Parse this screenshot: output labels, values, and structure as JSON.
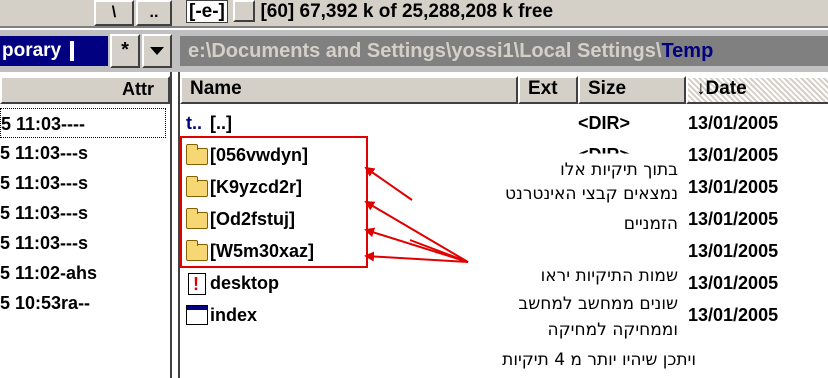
{
  "top_bar": {
    "btn1": "\\",
    "btn2": "..",
    "drive_select": "[-e-]",
    "drive_label": "[60]  67,392 k of 25,288,208 k free"
  },
  "path_bar": {
    "left_tab": "porary",
    "star": "*",
    "path_text": "e:\\Documents and Settings\\yossi1\\Local Settings\\",
    "path_end": "Temp"
  },
  "left_panel": {
    "header": "Attr",
    "rows": [
      "5 11:03----",
      "5 11:03---s",
      "5 11:03---s",
      "5 11:03---s",
      "5 11:03---s",
      "5 11:02-ahs",
      "5 10:53ra--"
    ]
  },
  "columns": {
    "name": "Name",
    "ext": "Ext",
    "size": "Size",
    "date": "↓Date"
  },
  "files": [
    {
      "name": "[..]",
      "icon": "up-dir-icon",
      "size": "<DIR>",
      "date": "13/01/2005"
    },
    {
      "name": "[056vwdyn]",
      "icon": "folder-icon",
      "size": "<DIR>",
      "date": "13/01/2005"
    },
    {
      "name": "[K9yzcd2r]",
      "icon": "folder-icon",
      "size": "",
      "date": "13/01/2005"
    },
    {
      "name": "[Od2fstuj]",
      "icon": "folder-icon",
      "size": "",
      "date": "13/01/2005"
    },
    {
      "name": "[W5m30xaz]",
      "icon": "folder-icon",
      "size": "",
      "date": "13/01/2005"
    },
    {
      "name": "desktop",
      "icon": "warning-file-icon",
      "size": "",
      "date": "13/01/2005"
    },
    {
      "name": "index",
      "icon": "window-file-icon",
      "size": "",
      "date": "13/01/2005"
    }
  ],
  "annotations": {
    "note1_line1": "בתוך תיקיות אלו",
    "note1_line2": "נמצאים קבצי האינטרנט",
    "note1_line3": "הזמניים",
    "note2_line1": "שמות התיקיות יראו",
    "note2_line2": "שונים ממחשב למחשב",
    "note2_line3": "וממחיקה למחיקה",
    "note3_line1": "ויתכן שיהיו יותר מ 4 תיקיות"
  },
  "colors": {
    "title_blue": "#000080",
    "annotation_red": "#e00000",
    "chrome_gray": "#d4d0c8"
  }
}
